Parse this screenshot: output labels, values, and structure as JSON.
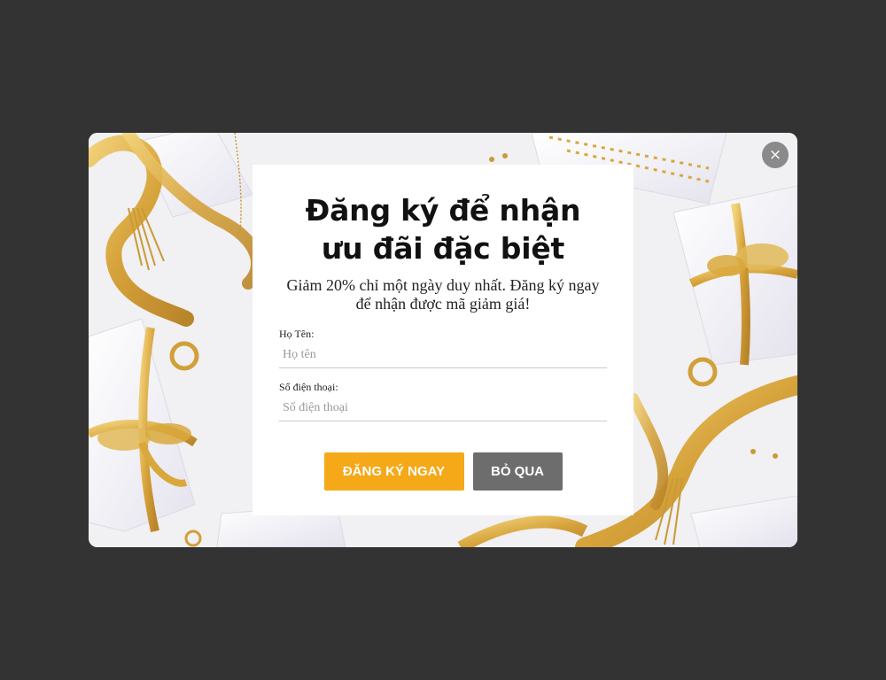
{
  "popup": {
    "close_label": "×",
    "title_line1": "Đăng ký để nhận",
    "title_line2": "ưu đãi đặc biệt",
    "subtitle": "Giảm 20% chỉ một ngày duy nhất. Đăng ký ngay để nhận được mã giảm giá!",
    "fields": [
      {
        "label": "Họ Tên:",
        "placeholder": "Họ tên",
        "value": ""
      },
      {
        "label": "Số điện thoại:",
        "placeholder": "Số điện thoại",
        "value": ""
      }
    ],
    "submit_label": "ĐĂNG KÝ NGAY",
    "skip_label": "BỎ QUA"
  },
  "colors": {
    "overlay": "#333333",
    "primary_button": "#f5a818",
    "secondary_button": "#6d6d6d",
    "gold_ribbon": "#d9a83c"
  },
  "icons": {
    "close": "close-icon"
  }
}
